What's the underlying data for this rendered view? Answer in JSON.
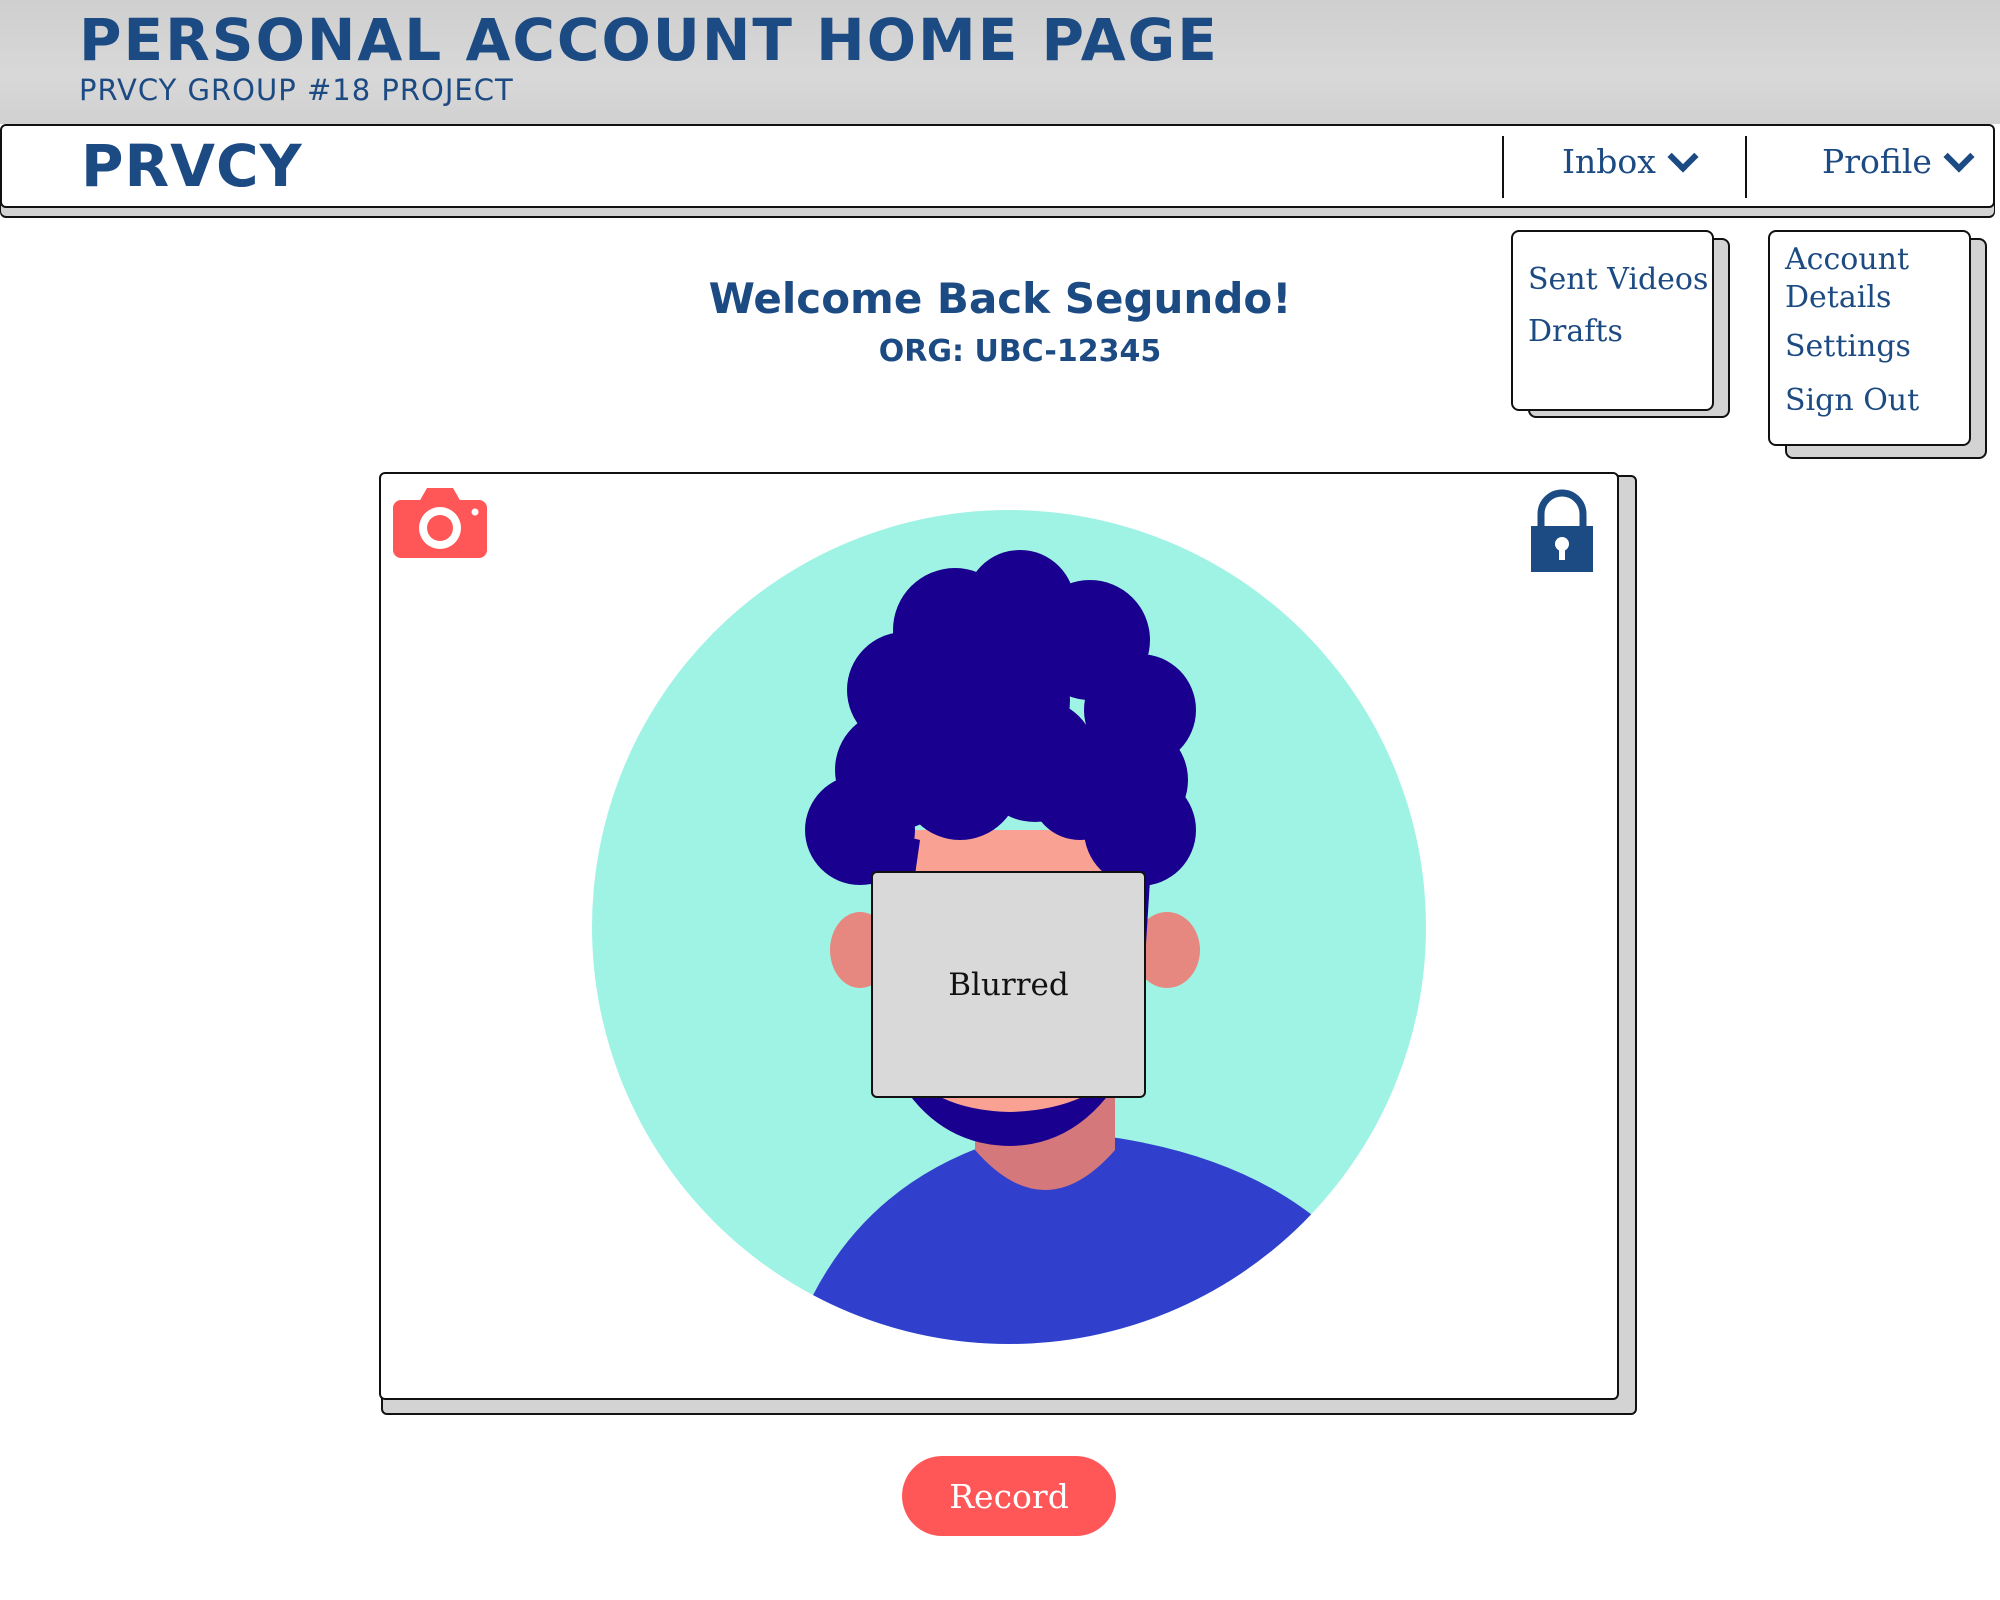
{
  "banner": {
    "title": "PERSONAL ACCOUNT HOME PAGE",
    "subtitle": "PRVCY GROUP #18 PROJECT"
  },
  "navbar": {
    "brand": "PRVCY",
    "inbox_label": "Inbox",
    "profile_label": "Profile"
  },
  "inbox_menu": {
    "items": [
      "Sent Videos",
      "Drafts"
    ]
  },
  "profile_menu": {
    "items": [
      "Account",
      "Details",
      "Settings",
      "Sign Out"
    ]
  },
  "welcome": {
    "heading": "Welcome Back Segundo!",
    "org": "ORG: UBC-12345"
  },
  "video": {
    "camera_icon": "camera-icon",
    "lock_icon": "lock-icon",
    "blur_label": "Blurred"
  },
  "record_button": "Record",
  "colors": {
    "brand_blue": "#1c4a82",
    "accent_red": "#ff5757",
    "avatar_bg": "#9ff3e5",
    "hair": "#1a008f",
    "shirt": "#3140cc",
    "skin": "#f9a193"
  }
}
